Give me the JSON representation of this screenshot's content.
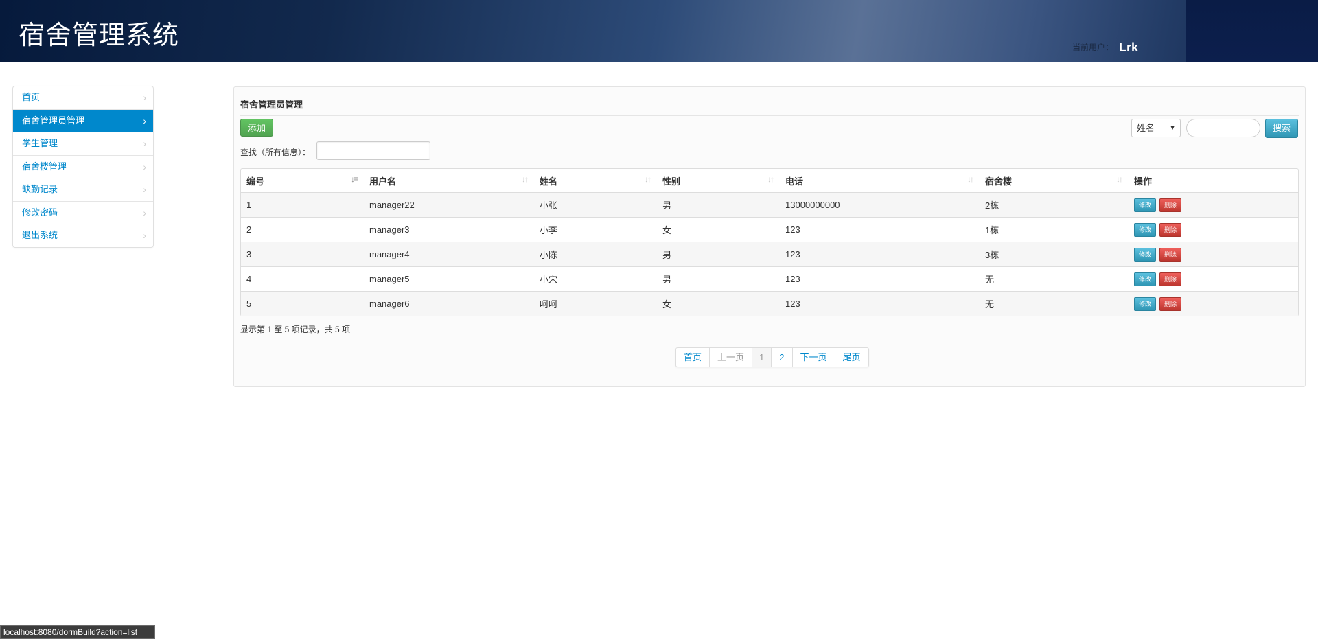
{
  "app": {
    "title": "宿舍管理系统",
    "user_label": "当前用户：",
    "user_name": "Lrk"
  },
  "sidebar": {
    "items": [
      {
        "label": "首页"
      },
      {
        "label": "宿舍管理员管理"
      },
      {
        "label": "学生管理"
      },
      {
        "label": "宿舍楼管理"
      },
      {
        "label": "缺勤记录"
      },
      {
        "label": "修改密码"
      },
      {
        "label": "退出系统"
      }
    ],
    "active_index": 1
  },
  "panel": {
    "title": "宿舍管理员管理",
    "add_label": "添加",
    "find_label": "查找（所有信息）：",
    "find_value": "",
    "search_field": "姓名",
    "search_value": "",
    "search_label": "搜索"
  },
  "table": {
    "columns": [
      "编号",
      "用户名",
      "姓名",
      "性别",
      "电话",
      "宿舍楼",
      "操作"
    ],
    "rows": [
      {
        "id": "1",
        "username": "manager22",
        "name": "小张",
        "gender": "男",
        "phone": "13000000000",
        "building": "2栋"
      },
      {
        "id": "2",
        "username": "manager3",
        "name": "小李",
        "gender": "女",
        "phone": "123",
        "building": "1栋"
      },
      {
        "id": "3",
        "username": "manager4",
        "name": "小陈",
        "gender": "男",
        "phone": "123",
        "building": "3栋"
      },
      {
        "id": "4",
        "username": "manager5",
        "name": "小宋",
        "gender": "男",
        "phone": "123",
        "building": "无"
      },
      {
        "id": "5",
        "username": "manager6",
        "name": "呵呵",
        "gender": "女",
        "phone": "123",
        "building": "无"
      }
    ],
    "edit_label": "修改",
    "delete_label": "删除"
  },
  "footer": {
    "record_info": "显示第 1 至 5 项记录，共 5 项",
    "pagination": {
      "first": "首页",
      "prev": "上一页",
      "pages": [
        "1",
        "2"
      ],
      "current": "1",
      "next": "下一页",
      "last": "尾页"
    }
  },
  "statusbar": {
    "url": "localhost:8080/dormBuild?action=list"
  }
}
